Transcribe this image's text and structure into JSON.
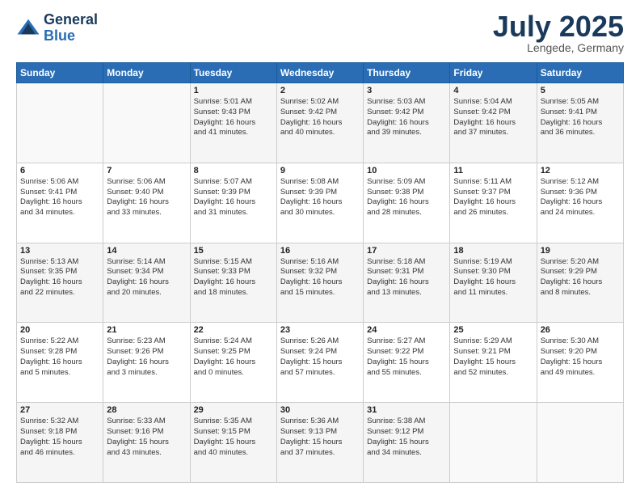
{
  "logo": {
    "general": "General",
    "blue": "Blue"
  },
  "header": {
    "month": "July 2025",
    "location": "Lengede, Germany"
  },
  "weekdays": [
    "Sunday",
    "Monday",
    "Tuesday",
    "Wednesday",
    "Thursday",
    "Friday",
    "Saturday"
  ],
  "weeks": [
    [
      {
        "day": "",
        "info": ""
      },
      {
        "day": "",
        "info": ""
      },
      {
        "day": "1",
        "info": "Sunrise: 5:01 AM\nSunset: 9:43 PM\nDaylight: 16 hours\nand 41 minutes."
      },
      {
        "day": "2",
        "info": "Sunrise: 5:02 AM\nSunset: 9:42 PM\nDaylight: 16 hours\nand 40 minutes."
      },
      {
        "day": "3",
        "info": "Sunrise: 5:03 AM\nSunset: 9:42 PM\nDaylight: 16 hours\nand 39 minutes."
      },
      {
        "day": "4",
        "info": "Sunrise: 5:04 AM\nSunset: 9:42 PM\nDaylight: 16 hours\nand 37 minutes."
      },
      {
        "day": "5",
        "info": "Sunrise: 5:05 AM\nSunset: 9:41 PM\nDaylight: 16 hours\nand 36 minutes."
      }
    ],
    [
      {
        "day": "6",
        "info": "Sunrise: 5:06 AM\nSunset: 9:41 PM\nDaylight: 16 hours\nand 34 minutes."
      },
      {
        "day": "7",
        "info": "Sunrise: 5:06 AM\nSunset: 9:40 PM\nDaylight: 16 hours\nand 33 minutes."
      },
      {
        "day": "8",
        "info": "Sunrise: 5:07 AM\nSunset: 9:39 PM\nDaylight: 16 hours\nand 31 minutes."
      },
      {
        "day": "9",
        "info": "Sunrise: 5:08 AM\nSunset: 9:39 PM\nDaylight: 16 hours\nand 30 minutes."
      },
      {
        "day": "10",
        "info": "Sunrise: 5:09 AM\nSunset: 9:38 PM\nDaylight: 16 hours\nand 28 minutes."
      },
      {
        "day": "11",
        "info": "Sunrise: 5:11 AM\nSunset: 9:37 PM\nDaylight: 16 hours\nand 26 minutes."
      },
      {
        "day": "12",
        "info": "Sunrise: 5:12 AM\nSunset: 9:36 PM\nDaylight: 16 hours\nand 24 minutes."
      }
    ],
    [
      {
        "day": "13",
        "info": "Sunrise: 5:13 AM\nSunset: 9:35 PM\nDaylight: 16 hours\nand 22 minutes."
      },
      {
        "day": "14",
        "info": "Sunrise: 5:14 AM\nSunset: 9:34 PM\nDaylight: 16 hours\nand 20 minutes."
      },
      {
        "day": "15",
        "info": "Sunrise: 5:15 AM\nSunset: 9:33 PM\nDaylight: 16 hours\nand 18 minutes."
      },
      {
        "day": "16",
        "info": "Sunrise: 5:16 AM\nSunset: 9:32 PM\nDaylight: 16 hours\nand 15 minutes."
      },
      {
        "day": "17",
        "info": "Sunrise: 5:18 AM\nSunset: 9:31 PM\nDaylight: 16 hours\nand 13 minutes."
      },
      {
        "day": "18",
        "info": "Sunrise: 5:19 AM\nSunset: 9:30 PM\nDaylight: 16 hours\nand 11 minutes."
      },
      {
        "day": "19",
        "info": "Sunrise: 5:20 AM\nSunset: 9:29 PM\nDaylight: 16 hours\nand 8 minutes."
      }
    ],
    [
      {
        "day": "20",
        "info": "Sunrise: 5:22 AM\nSunset: 9:28 PM\nDaylight: 16 hours\nand 5 minutes."
      },
      {
        "day": "21",
        "info": "Sunrise: 5:23 AM\nSunset: 9:26 PM\nDaylight: 16 hours\nand 3 minutes."
      },
      {
        "day": "22",
        "info": "Sunrise: 5:24 AM\nSunset: 9:25 PM\nDaylight: 16 hours\nand 0 minutes."
      },
      {
        "day": "23",
        "info": "Sunrise: 5:26 AM\nSunset: 9:24 PM\nDaylight: 15 hours\nand 57 minutes."
      },
      {
        "day": "24",
        "info": "Sunrise: 5:27 AM\nSunset: 9:22 PM\nDaylight: 15 hours\nand 55 minutes."
      },
      {
        "day": "25",
        "info": "Sunrise: 5:29 AM\nSunset: 9:21 PM\nDaylight: 15 hours\nand 52 minutes."
      },
      {
        "day": "26",
        "info": "Sunrise: 5:30 AM\nSunset: 9:20 PM\nDaylight: 15 hours\nand 49 minutes."
      }
    ],
    [
      {
        "day": "27",
        "info": "Sunrise: 5:32 AM\nSunset: 9:18 PM\nDaylight: 15 hours\nand 46 minutes."
      },
      {
        "day": "28",
        "info": "Sunrise: 5:33 AM\nSunset: 9:16 PM\nDaylight: 15 hours\nand 43 minutes."
      },
      {
        "day": "29",
        "info": "Sunrise: 5:35 AM\nSunset: 9:15 PM\nDaylight: 15 hours\nand 40 minutes."
      },
      {
        "day": "30",
        "info": "Sunrise: 5:36 AM\nSunset: 9:13 PM\nDaylight: 15 hours\nand 37 minutes."
      },
      {
        "day": "31",
        "info": "Sunrise: 5:38 AM\nSunset: 9:12 PM\nDaylight: 15 hours\nand 34 minutes."
      },
      {
        "day": "",
        "info": ""
      },
      {
        "day": "",
        "info": ""
      }
    ]
  ]
}
